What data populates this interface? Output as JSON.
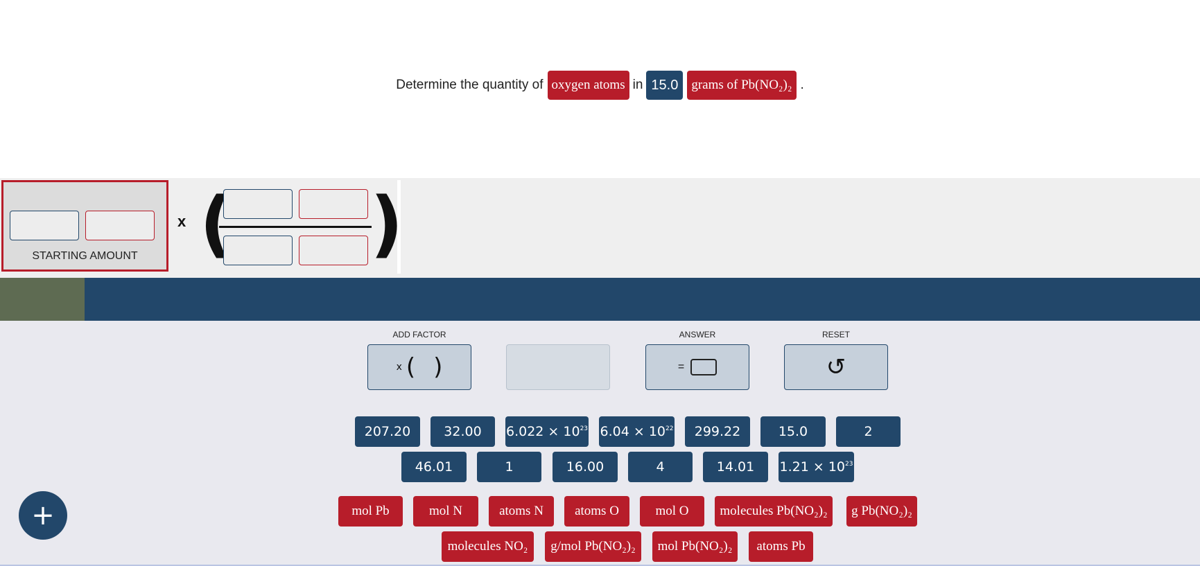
{
  "question": {
    "prefix": "Determine the quantity of",
    "target_unit": "oxygen atoms",
    "connector": "in",
    "given_value": "15.0",
    "given_unit": "grams of Pb(NO₂)₂",
    "suffix": "."
  },
  "equation": {
    "starting_amount_label": "STARTING AMOUNT",
    "multiply_symbol": "x",
    "open_paren": "(",
    "close_paren": ")"
  },
  "controls": {
    "add_factor_label": "ADD FACTOR",
    "add_factor_glyph": {
      "x": "x",
      "open": "(",
      "close": ")"
    },
    "answer_label": "ANSWER",
    "answer_glyph": "=",
    "reset_label": "RESET",
    "reset_icon": "↺"
  },
  "number_tiles_row1": [
    {
      "base": "207.20"
    },
    {
      "base": "32.00"
    },
    {
      "base": "6.022 × 10",
      "exp": "23"
    },
    {
      "base": "6.04 × 10",
      "exp": "22"
    },
    {
      "base": "299.22"
    },
    {
      "base": "15.0"
    },
    {
      "base": "2"
    }
  ],
  "number_tiles_row2": [
    {
      "base": "46.01"
    },
    {
      "base": "1"
    },
    {
      "base": "16.00"
    },
    {
      "base": "4"
    },
    {
      "base": "14.01"
    },
    {
      "base": "1.21 × 10",
      "exp": "23"
    }
  ],
  "unit_tiles_row1": [
    "mol Pb",
    "mol N",
    "atoms N",
    "atoms O",
    "mol O",
    "molecules Pb(NO₂)₂",
    "g Pb(NO₂)₂"
  ],
  "unit_tiles_row2": [
    "molecules NO₂",
    "g/mol Pb(NO₂)₂",
    "mol Pb(NO₂)₂",
    "atoms Pb"
  ],
  "fab": {
    "icon": "+"
  },
  "colors": {
    "accent_blue": "#22476a",
    "accent_red": "#b71d2a",
    "progress": "#5e6b52"
  }
}
